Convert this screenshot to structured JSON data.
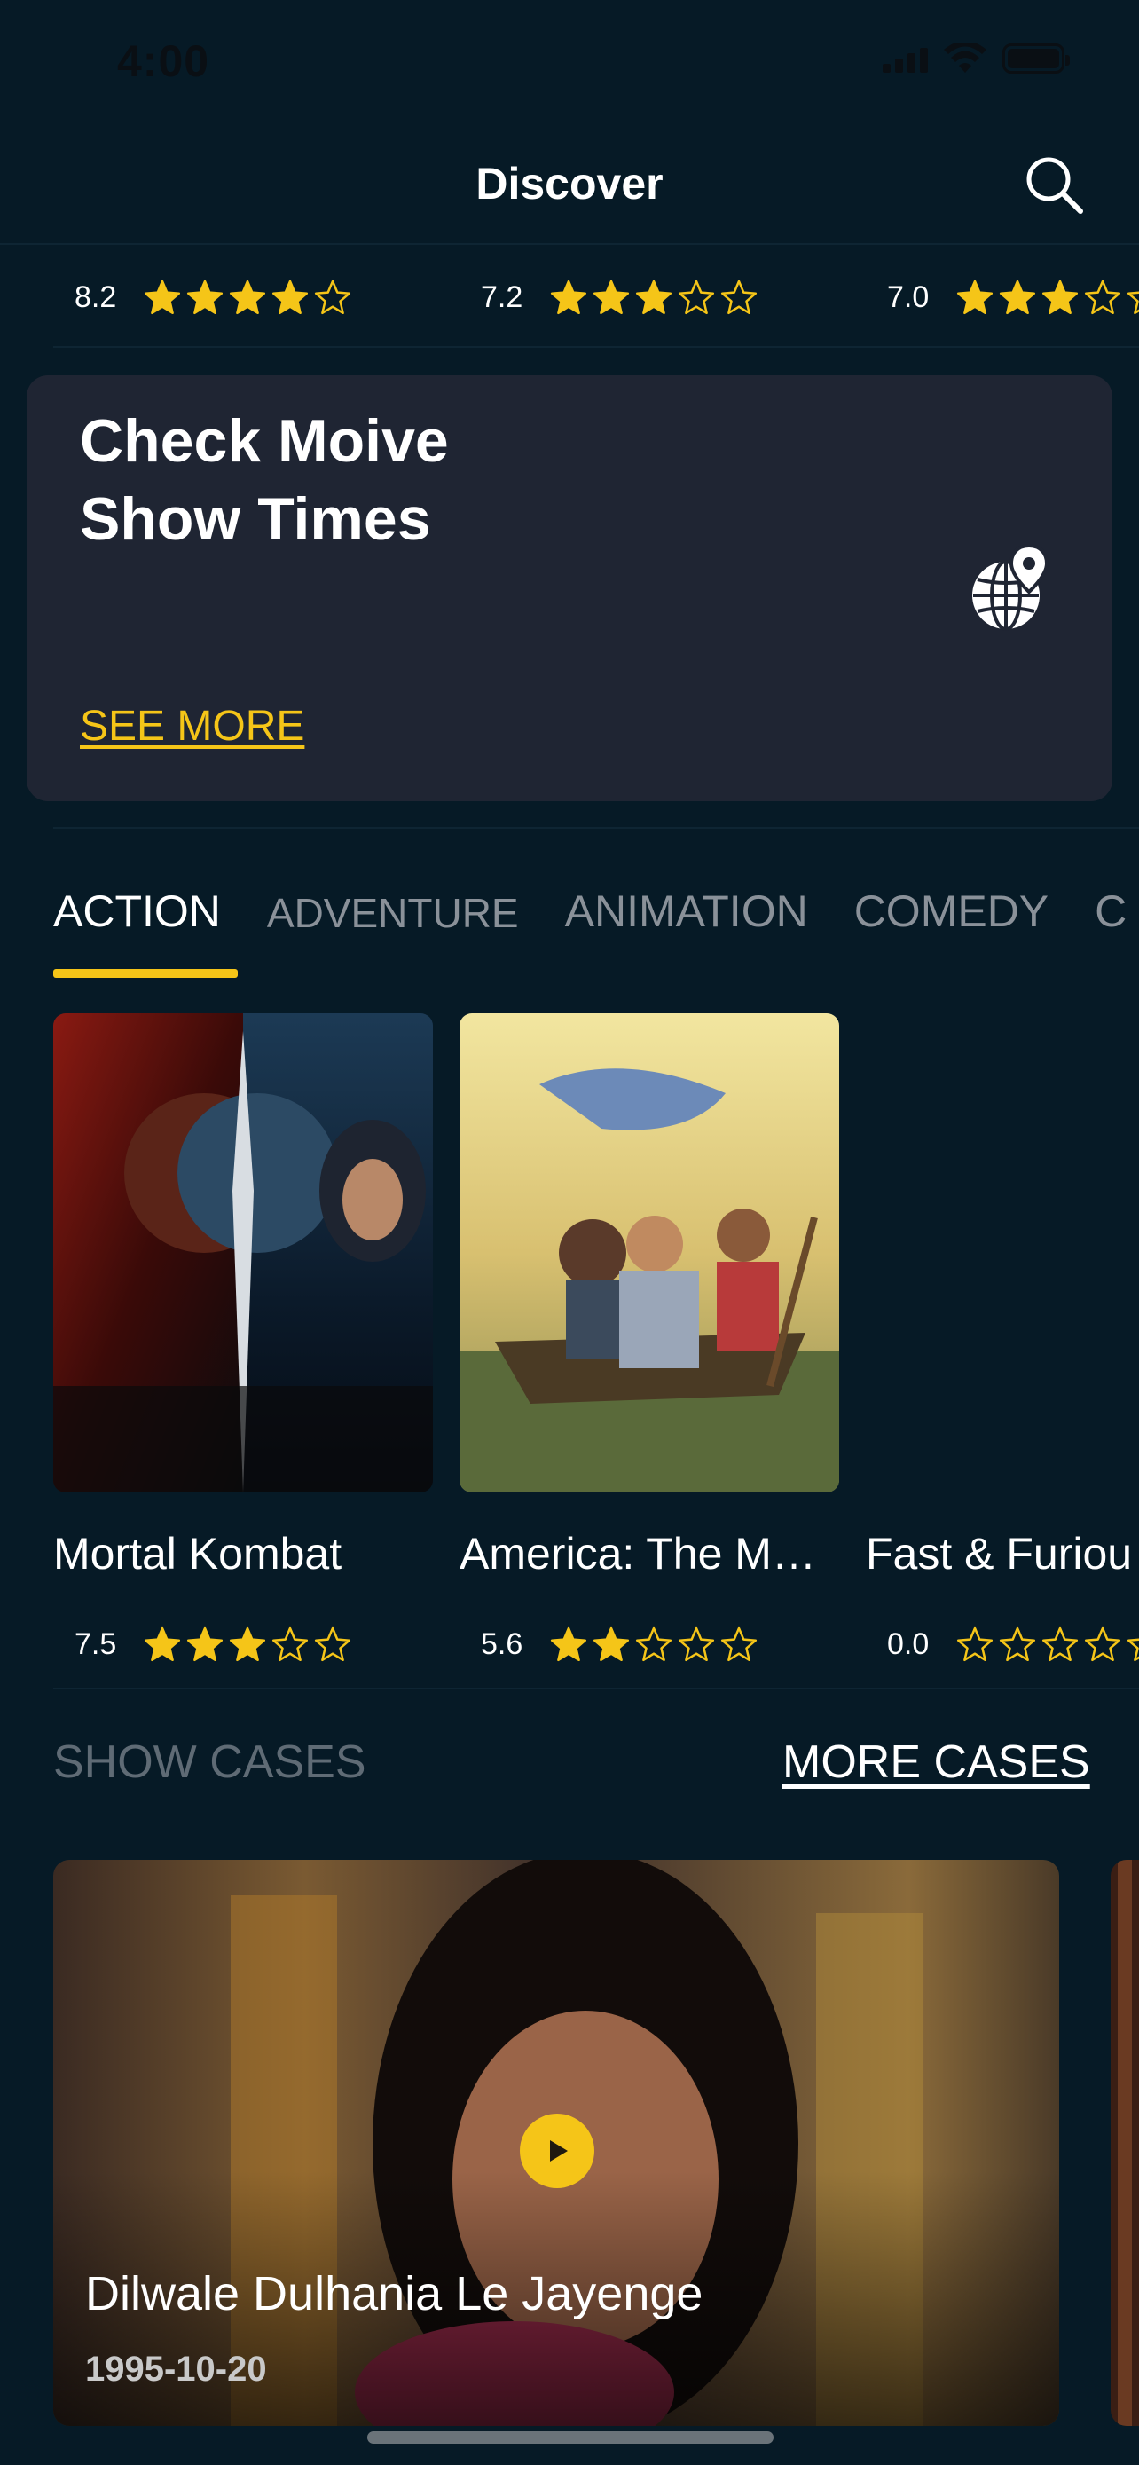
{
  "status_bar": {
    "time": "4:00"
  },
  "nav": {
    "title": "Discover",
    "search_icon": "search-icon"
  },
  "top_ratings": [
    {
      "value": "8.2",
      "stars": 4
    },
    {
      "value": "7.2",
      "stars": 3
    },
    {
      "value": "7.0",
      "stars": 3
    }
  ],
  "showtimes_card": {
    "title": "Check Moive\nShow Times",
    "link": "SEE MORE",
    "icon": "globe-location-icon"
  },
  "tabs": [
    "ACTION",
    "ADVENTURE",
    "ANIMATION",
    "COMEDY",
    "C"
  ],
  "active_tab": "ACTION",
  "movies": [
    {
      "title": "Mortal Kombat",
      "rating": "7.5",
      "stars": 3
    },
    {
      "title": "America: The M…",
      "rating": "5.6",
      "stars": 2
    },
    {
      "title": "Fast & Furiou",
      "rating": "0.0",
      "stars": 0
    }
  ],
  "showcases": {
    "label": "SHOW CASES",
    "more": "MORE CASES",
    "items": [
      {
        "title": "Dilwale Dulhania Le Jayenge",
        "date": "1995-10-20"
      }
    ]
  },
  "colors": {
    "background": "#061a26",
    "card": "#1f2533",
    "accent": "#f5c518"
  }
}
